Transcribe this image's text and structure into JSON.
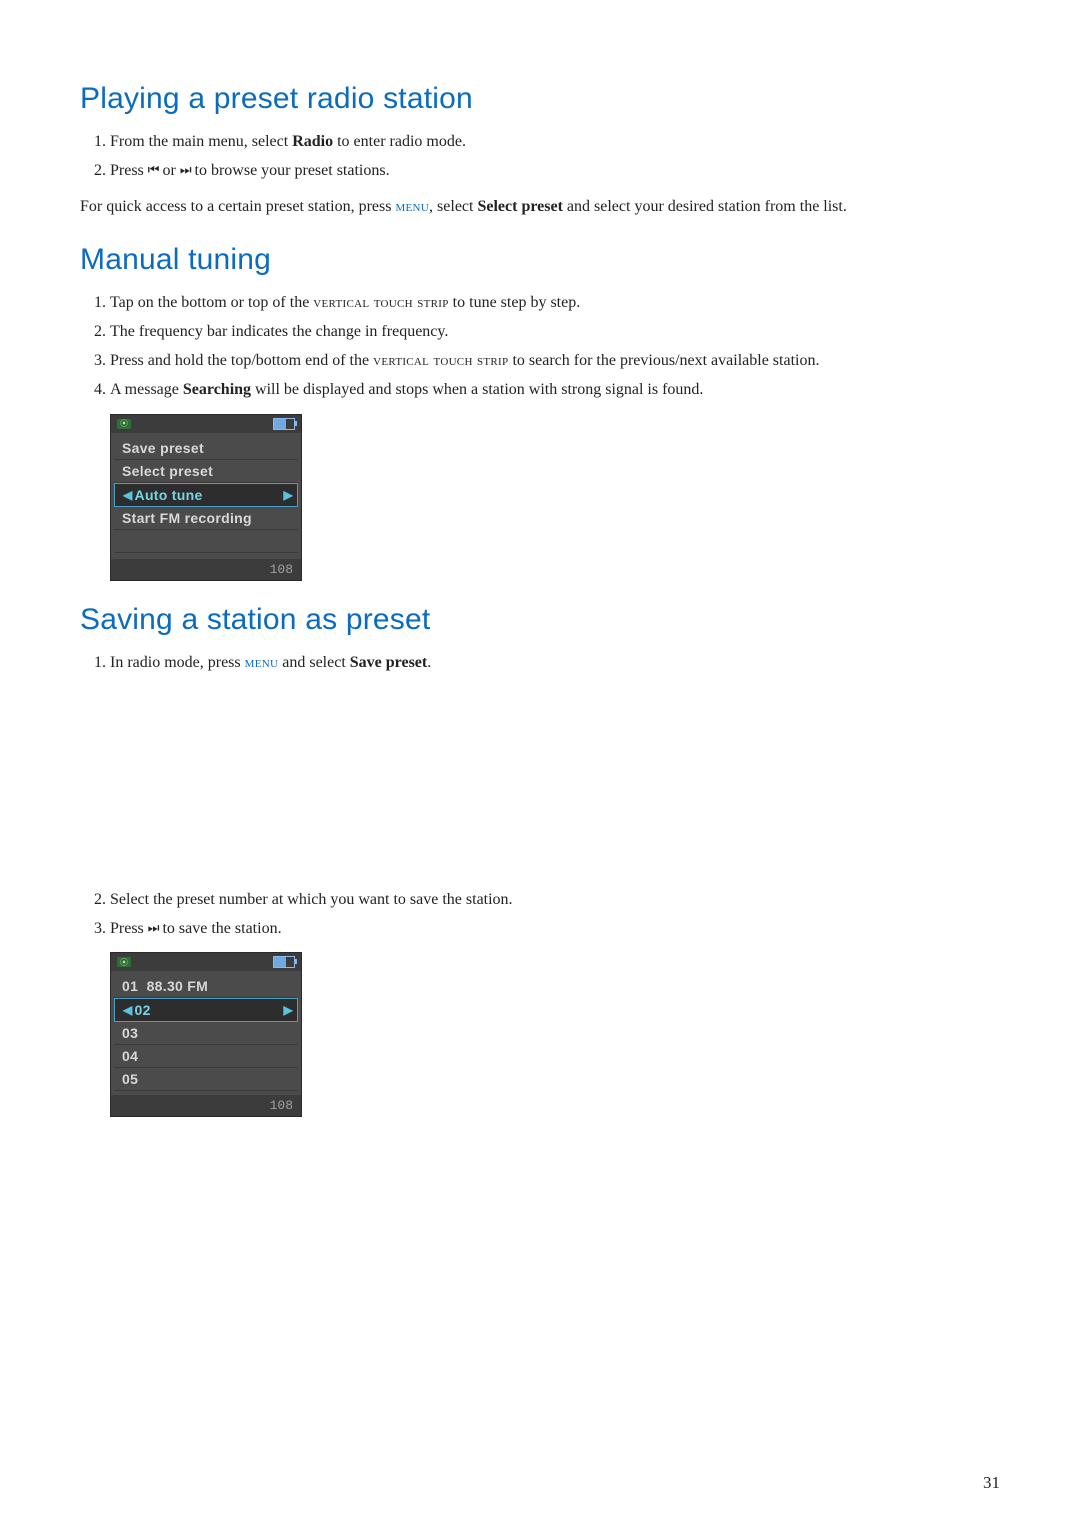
{
  "section_playing": {
    "heading": "Playing a preset radio station",
    "step1_prefix": "From the main menu, select ",
    "step1_bold": "Radio",
    "step1_suffix": " to enter radio mode.",
    "step2_prefix": "Press ",
    "step2_icon_prev": "⏮",
    "step2_or": " or ",
    "step2_icon_next": "⏭",
    "step2_suffix": " to browse your preset stations.",
    "note_prefix": "For quick access to a certain preset station, press ",
    "note_menu": "menu",
    "note_mid": ", select ",
    "note_bold": "Select preset",
    "note_suffix": " and select your desired station from the list."
  },
  "section_manual": {
    "heading": "Manual tuning",
    "step1_prefix": "Tap on the bottom or top of the ",
    "step1_smallcaps": "vertical touch strip",
    "step1_suffix": " to tune step by step.",
    "step2": "The frequency bar indicates the change in frequency.",
    "step3_prefix": "Press and hold the top/bottom end of the ",
    "step3_smallcaps": "vertical touch strip",
    "step3_suffix": " to search for the previous/next available station.",
    "step4_prefix": "A message ",
    "step4_bold": "Searching",
    "step4_suffix": " will be displayed and stops when a station with strong signal is found."
  },
  "device1": {
    "rows": [
      "Save preset",
      "Select preset",
      "Auto tune",
      "Start FM recording"
    ],
    "selected_index": 2,
    "footer": "108"
  },
  "section_saving": {
    "heading": "Saving a station as preset",
    "step1_prefix": "In radio mode, press ",
    "step1_menu": "menu",
    "step1_mid": " and select ",
    "step1_bold": "Save preset",
    "step1_suffix": ".",
    "step2": "Select the preset number at which you want to save the station.",
    "step3_prefix": "Press ",
    "step3_icon": "⏭",
    "step3_suffix": " to save the station."
  },
  "device2": {
    "rows": [
      {
        "num": "01",
        "freq": "88.30 FM"
      },
      {
        "num": "02",
        "freq": ""
      },
      {
        "num": "03",
        "freq": ""
      },
      {
        "num": "04",
        "freq": ""
      },
      {
        "num": "05",
        "freq": ""
      }
    ],
    "selected_index": 1,
    "footer": "108"
  },
  "page_number": "31"
}
